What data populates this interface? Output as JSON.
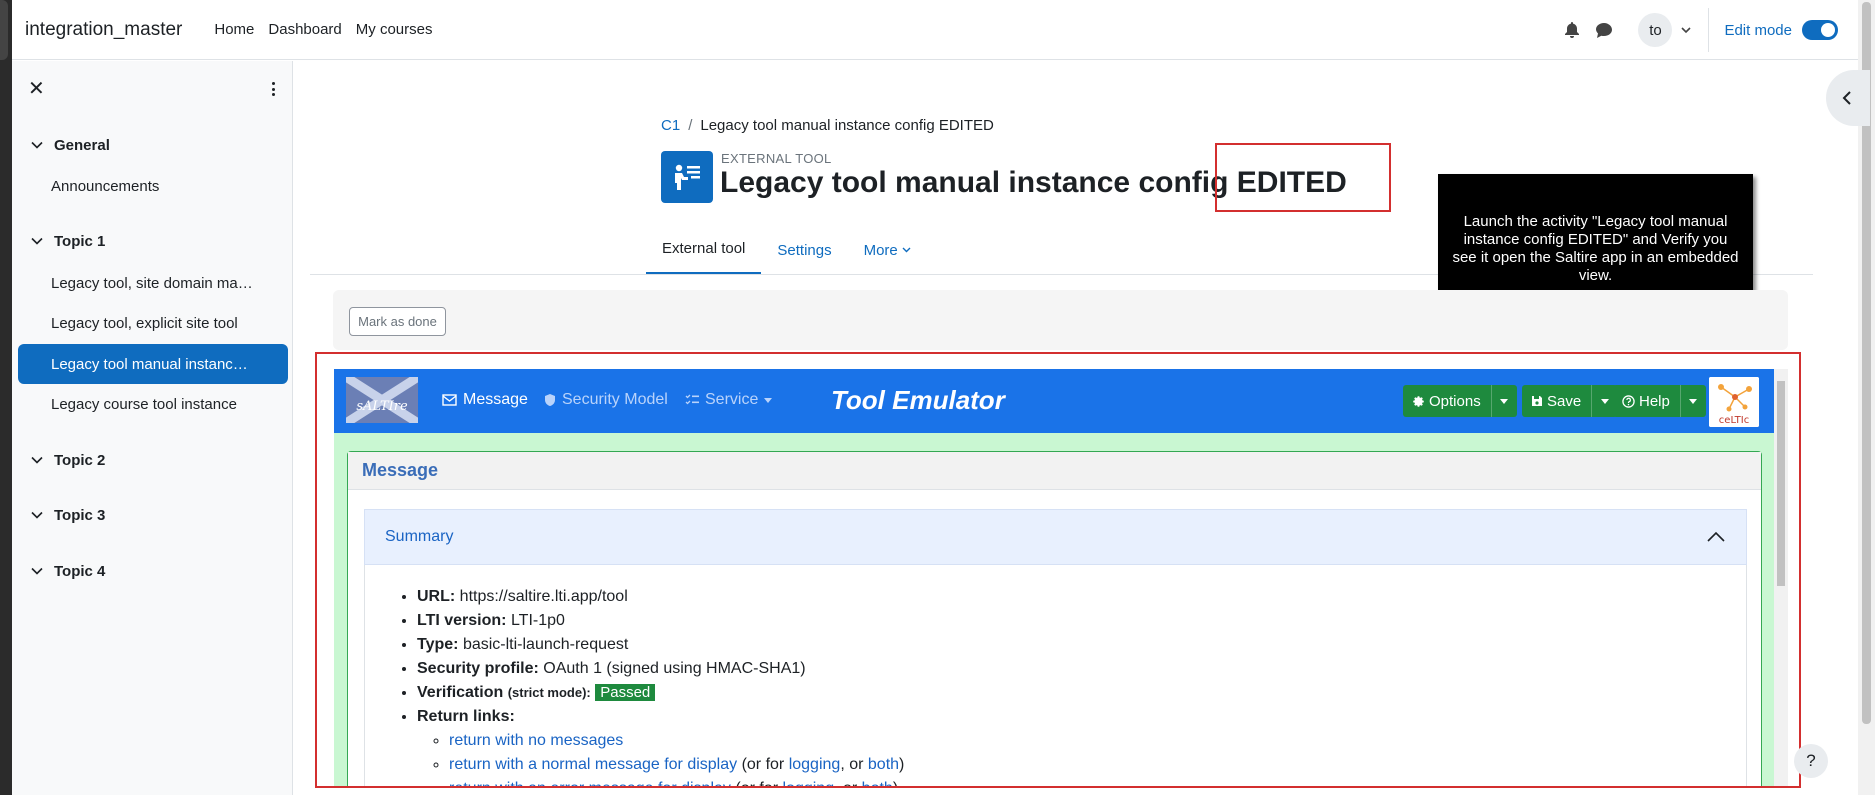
{
  "site": {
    "name": "integration_master"
  },
  "primary_nav": [
    {
      "label": "Home"
    },
    {
      "label": "Dashboard"
    },
    {
      "label": "My courses"
    }
  ],
  "user": {
    "initials": "to"
  },
  "edit_mode": {
    "label": "Edit mode",
    "enabled": true
  },
  "drawer": {
    "sections": [
      {
        "title": "General",
        "items": [
          "Announcements"
        ]
      },
      {
        "title": "Topic 1",
        "items": [
          "Legacy tool, site domain ma…",
          "Legacy tool, explicit site tool",
          "Legacy tool manual instanc…",
          "Legacy course tool instance"
        ]
      },
      {
        "title": "Topic 2"
      },
      {
        "title": "Topic 3"
      },
      {
        "title": "Topic 4"
      }
    ]
  },
  "breadcrumb": {
    "course": "C1",
    "separator": "/",
    "current": "Legacy tool manual instance config EDITED"
  },
  "header": {
    "pre_title": "EXTERNAL TOOL",
    "title": "Legacy tool manual instance config EDITED"
  },
  "tabs": [
    {
      "label": "External tool"
    },
    {
      "label": "Settings"
    },
    {
      "label": "More"
    }
  ],
  "tooltip": {
    "text": "Launch the activity \"Legacy tool manual instance config EDITED\" and Verify you see it open the Saltire app in an embedded view."
  },
  "completion": {
    "label": "Mark as done"
  },
  "tool": {
    "logo_text": "sALTIre",
    "nav": [
      {
        "label": "Message"
      },
      {
        "label": "Security Model"
      },
      {
        "label": "Service"
      }
    ],
    "title": "Tool Emulator",
    "buttons": [
      {
        "label": "Options"
      },
      {
        "label": "Save"
      },
      {
        "label": "Help"
      }
    ],
    "celtic_text": "ceLTIc",
    "panel_title": "Message",
    "summary_title": "Summary",
    "summary": {
      "url_label": "URL:",
      "url": "https://saltire.lti.app/tool",
      "lti_label": "LTI version:",
      "lti": "LTI-1p0",
      "type_label": "Type:",
      "type": "basic-lti-launch-request",
      "sec_label": "Security profile:",
      "sec": "OAuth 1 (signed using HMAC-SHA1)",
      "ver_label": "Verification",
      "ver_mode": "(strict mode):",
      "ver_status": "Passed",
      "ret_label": "Return links:",
      "ret1": "return with no messages",
      "ret2": "return with a normal message for display",
      "ret3": "return with an error message for display",
      "or_for": "(or for",
      "logging": "logging",
      "or": ", or",
      "both": "both",
      "close": ")"
    }
  },
  "help_button": "?",
  "colors": {
    "primary": "#0f6cbf",
    "tool_nav": "#1a73e8",
    "tool_button": "#1e8a3e",
    "highlight": "#d32f2f"
  }
}
